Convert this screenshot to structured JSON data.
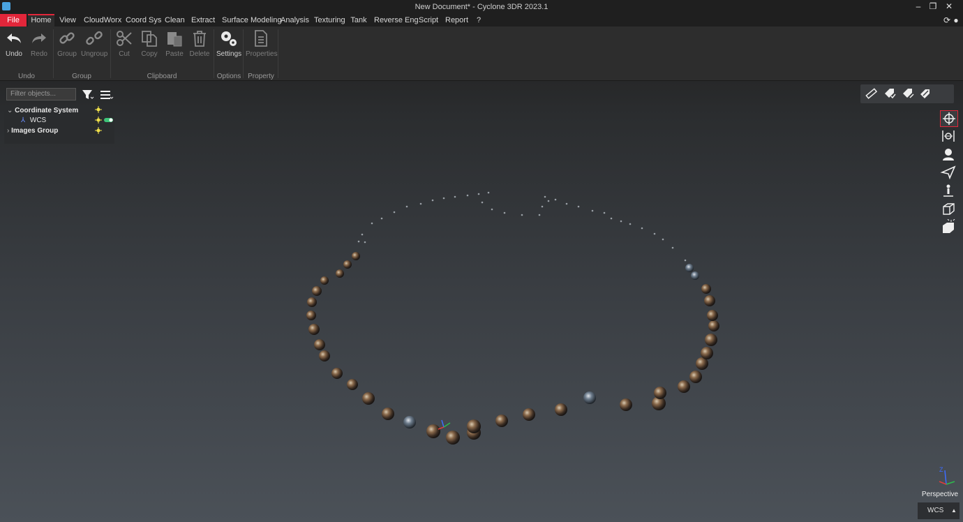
{
  "window": {
    "title": "New Document* - Cyclone 3DR 2023.1"
  },
  "menu": {
    "items": [
      "File",
      "Home",
      "View",
      "CloudWorx",
      "Coord Sys",
      "Clean",
      "Extract",
      "Surface Modeling",
      "Analysis",
      "Texturing",
      "Tank",
      "Reverse Eng",
      "Script",
      "Report",
      "?"
    ]
  },
  "ribbon": {
    "undo": "Undo",
    "redo": "Redo",
    "group": "Group",
    "ungroup": "Ungroup",
    "cut": "Cut",
    "copy": "Copy",
    "paste": "Paste",
    "delete": "Delete",
    "settings": "Settings",
    "properties": "Properties",
    "groups": {
      "undo": "Undo",
      "group": "Group",
      "clipboard": "Clipboard",
      "options": "Options",
      "property": "Property"
    }
  },
  "tree": {
    "filter_placeholder": "Filter objects...",
    "coordinate_system": "Coordinate System",
    "wcs": "WCS",
    "images_group": "Images Group"
  },
  "viewport": {
    "projection": "Perspective",
    "coord_system": "WCS"
  },
  "colors": {
    "accent": "#e2263a",
    "background_top": "#2a2c2e",
    "background_bottom": "#4b5158"
  }
}
